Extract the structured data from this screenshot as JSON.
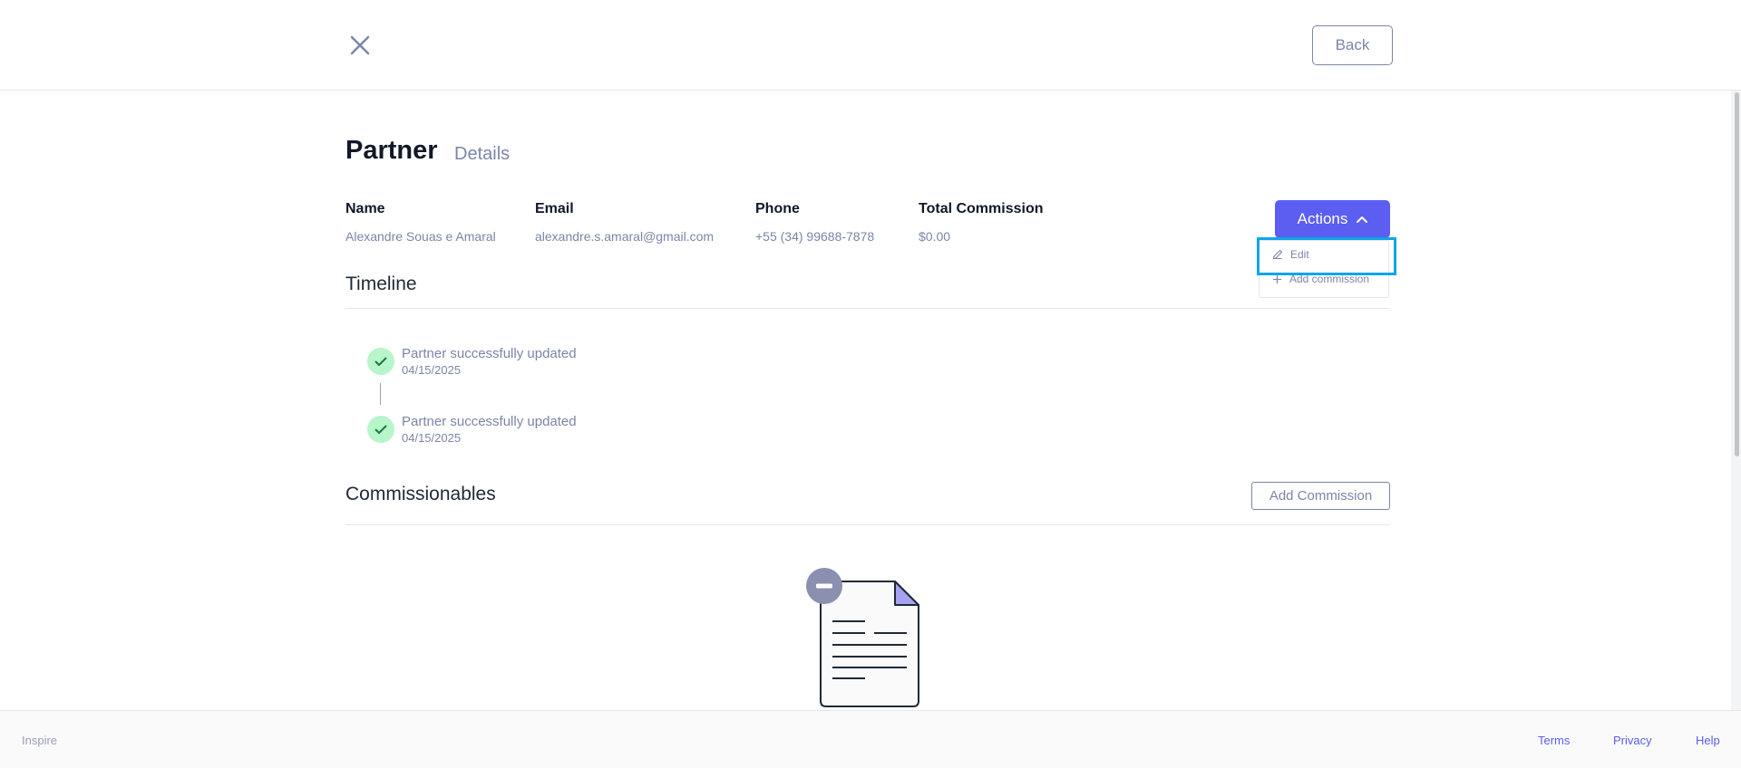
{
  "topbar": {
    "close_icon": "close-icon",
    "back_label": "Back"
  },
  "header": {
    "title": "Partner",
    "subtitle": "Details"
  },
  "fields": [
    {
      "label": "Name",
      "value": "Alexandre Souas e Amaral"
    },
    {
      "label": "Email",
      "value": "alexandre.s.amaral@gmail.com"
    },
    {
      "label": "Phone",
      "value": "+55 (34) 99688-7878"
    },
    {
      "label": "Total Commission",
      "value": "$0.00"
    }
  ],
  "actions": {
    "label": "Actions",
    "icon": "chevron-up-icon",
    "menu": [
      {
        "label": "Edit",
        "icon": "pencil-icon"
      },
      {
        "label": "Add commission",
        "icon": "plus-icon"
      }
    ]
  },
  "timeline": {
    "title": "Timeline",
    "events": [
      {
        "title": "Partner successfully updated",
        "date": "04/15/2025",
        "icon": "check-icon"
      },
      {
        "title": "Partner successfully updated",
        "date": "04/15/2025",
        "icon": "check-icon"
      }
    ]
  },
  "commissionables": {
    "title": "Commissionables",
    "add_label": "Add Commission",
    "empty_icon": "empty-document-icon"
  },
  "footer": {
    "brand": "Inspire",
    "links": [
      "Terms",
      "Privacy",
      "Help"
    ]
  },
  "colors": {
    "accent": "#5b5ef0",
    "muted_text": "#7c85a8",
    "success_bg": "#b7f5cb",
    "success_fg": "#1a7a3e",
    "highlight": "#0ea5e9"
  }
}
